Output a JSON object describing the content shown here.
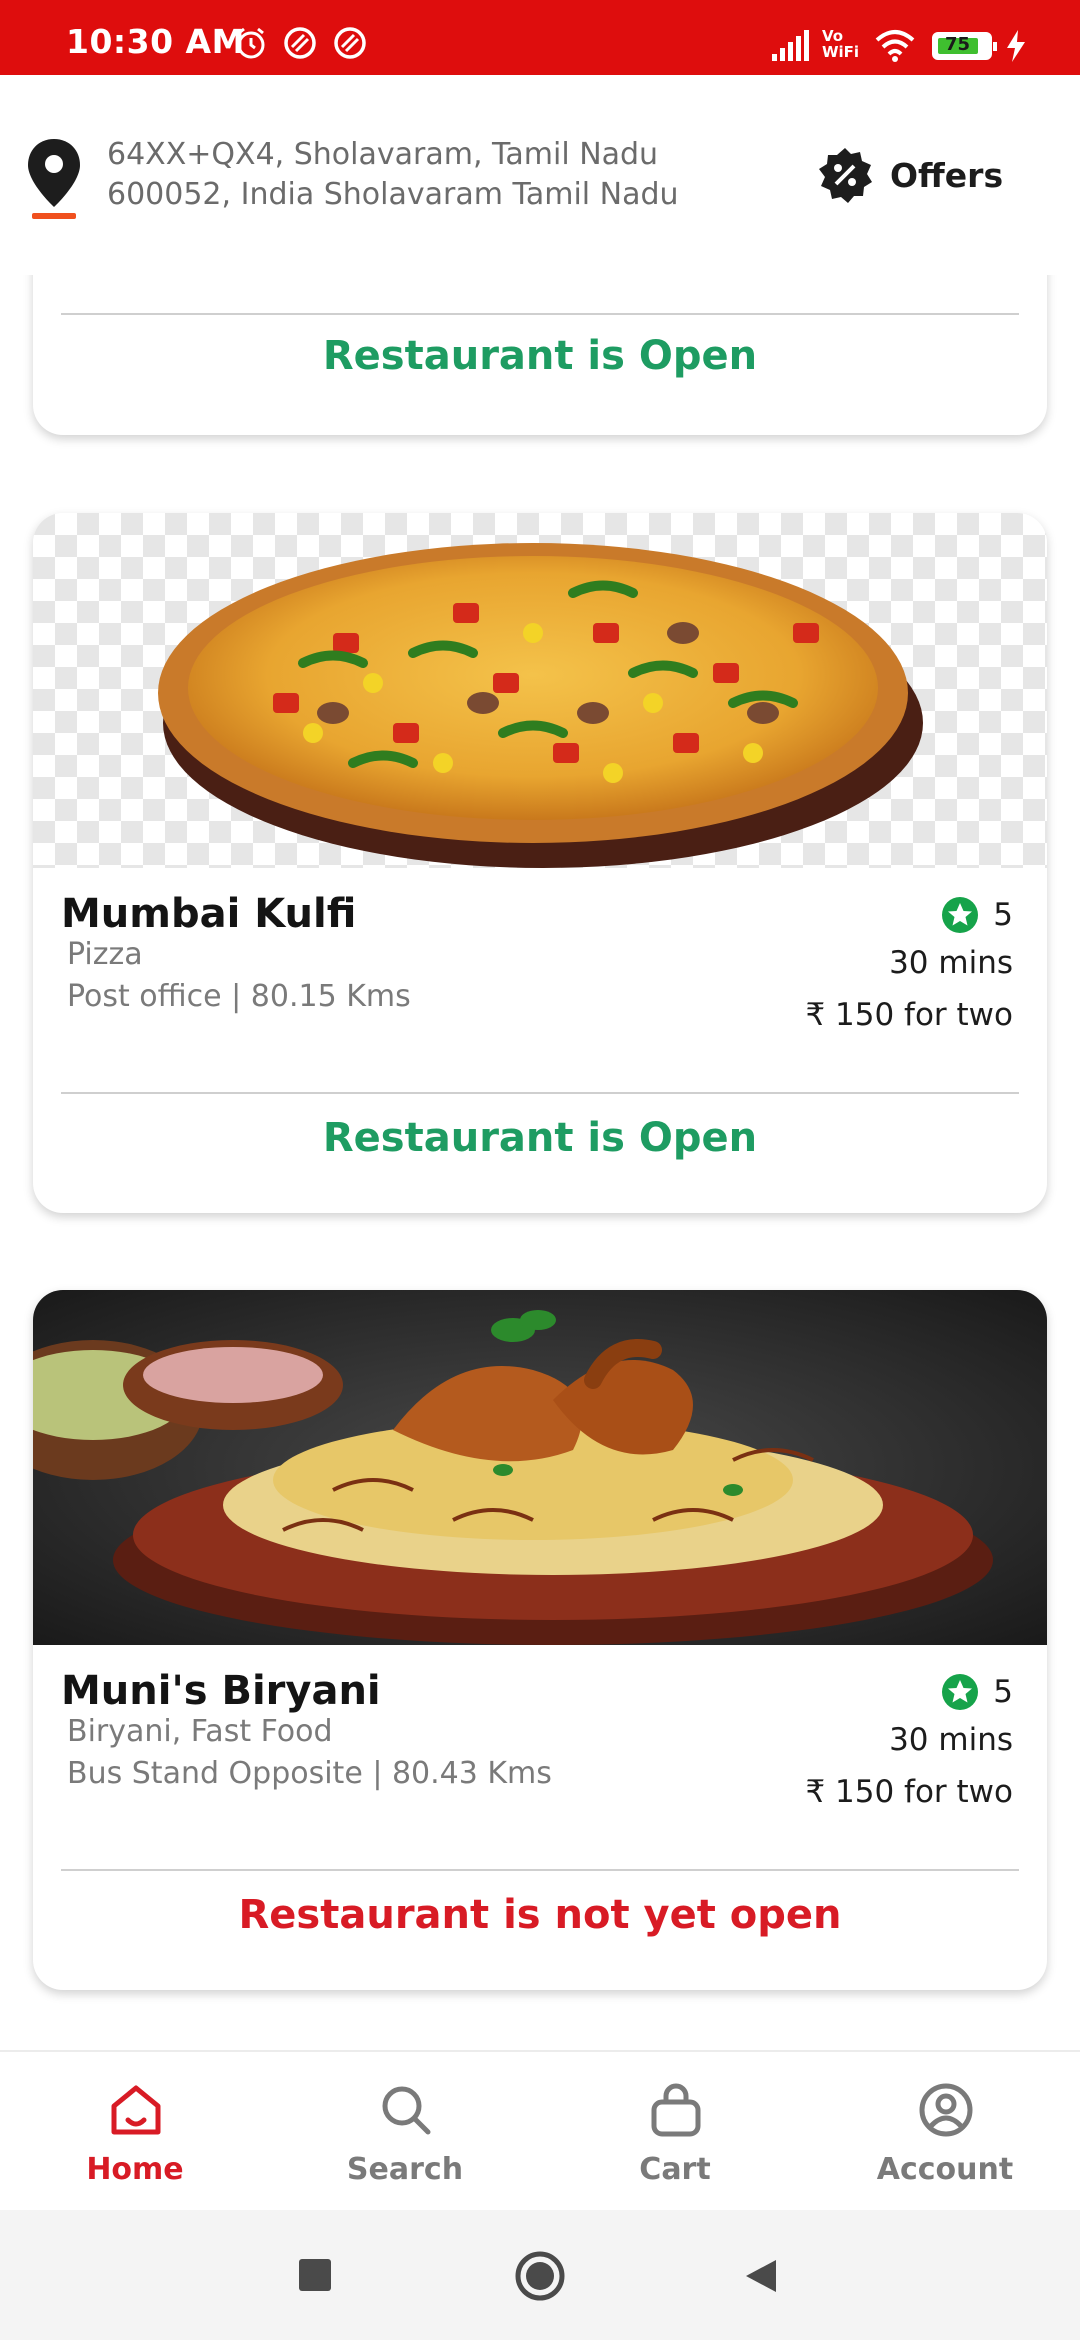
{
  "status_bar": {
    "time": "10:30 AM",
    "battery": "75",
    "network": "Vo WiFi"
  },
  "header": {
    "address_line1": "64XX+QX4, Sholavaram, Tamil Nadu",
    "address_line2": "600052, India Sholavaram Tamil Nadu",
    "offers_label": "Offers"
  },
  "cards": [
    {
      "status": "Restaurant is Open"
    },
    {
      "name": "Mumbai Kulfi",
      "cuisine": "Pizza",
      "location": "Post office  | 80.15 Kms",
      "rating": "5",
      "time": "30 mins",
      "price": "₹ 150 for two",
      "status": "Restaurant is Open"
    },
    {
      "name": "Muni's Biryani",
      "cuisine": "Biryani, Fast Food",
      "location": "Bus Stand Opposite  | 80.43 Kms",
      "rating": "5",
      "time": "30 mins",
      "price": "₹ 150 for two",
      "status": "Restaurant is not yet open"
    }
  ],
  "nav": {
    "home": "Home",
    "search": "Search",
    "cart": "Cart",
    "account": "Account"
  },
  "colors": {
    "brand_red": "#de0d0d",
    "open_green": "#1e9c62",
    "closed_red": "#d81b25",
    "rating_green": "#16a34a"
  },
  "icons": [
    "alarm-icon",
    "dnd-icon",
    "signal-icon",
    "wifi-icon",
    "battery-icon",
    "location-pin-icon",
    "offers-badge-icon",
    "star-icon",
    "home-icon",
    "search-icon",
    "cart-icon",
    "account-icon",
    "recents-icon",
    "home-circle-icon",
    "back-icon"
  ]
}
